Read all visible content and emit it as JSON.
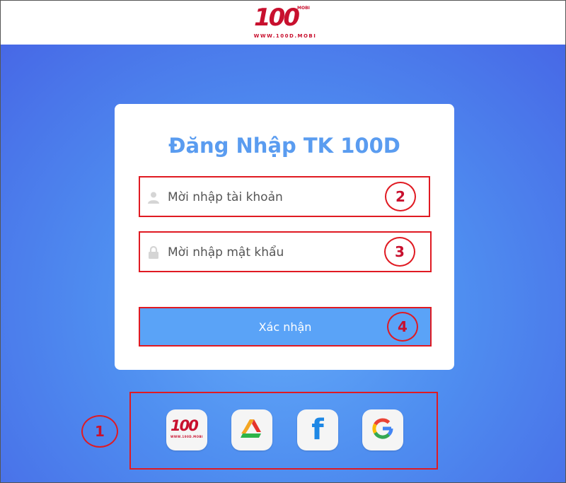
{
  "brand": {
    "logo_text": "100",
    "logo_sub": "MOBI",
    "logo_url": "WWW.100D.MOBI",
    "accent_color": "#c8102e"
  },
  "login": {
    "title": "Đăng Nhập TK 100D",
    "username_placeholder": "Mời nhập tài khoản",
    "password_placeholder": "Mời nhập mật khẩu",
    "submit_label": "Xác nhận",
    "primary_color": "#5aa3f7"
  },
  "social": {
    "logo_text": "100",
    "logo_url": "WWW.100D.MOBI",
    "facebook_letter": "f",
    "google_letter": "G",
    "items": [
      "100d-logo-icon",
      "recycle-triangle-icon",
      "facebook-icon",
      "google-icon"
    ]
  },
  "annotations": {
    "labels": [
      "1",
      "2",
      "3",
      "4"
    ],
    "color": "#e01a22"
  }
}
